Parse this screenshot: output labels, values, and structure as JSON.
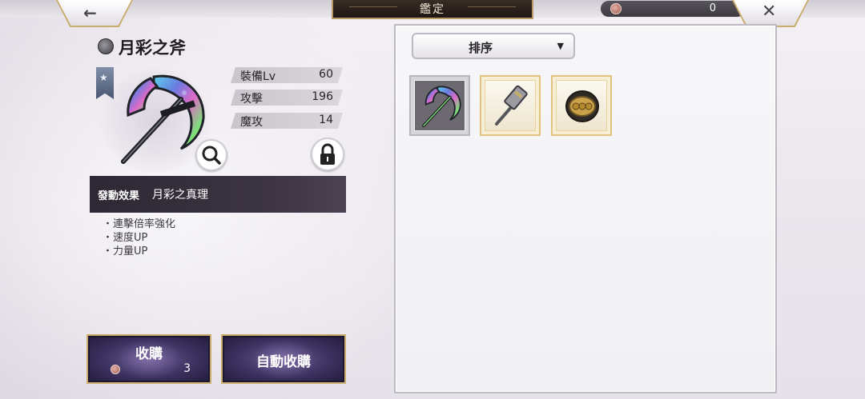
{
  "header": {
    "title": "鑑定",
    "back_icon": "←",
    "close_icon": "✕",
    "currency_amount": "0"
  },
  "item": {
    "name": "月彩之斧",
    "stats": [
      {
        "label": "裝備Lv",
        "value": "60"
      },
      {
        "label": "攻擊",
        "value": "196"
      },
      {
        "label": "魔攻",
        "value": "14"
      }
    ],
    "effect_heading": "發動效果",
    "effect_name": "月彩之真理",
    "effects": [
      "・連擊倍率強化",
      "・速度UP",
      "・力量UP"
    ]
  },
  "actions": {
    "buy_label": "收購",
    "buy_cost": "3",
    "auto_buy_label": "自動收購"
  },
  "inventory": {
    "sort_label": "排序",
    "items": [
      {
        "name": "moon-axe",
        "frame": "selected"
      },
      {
        "name": "hammer",
        "frame": "gold"
      },
      {
        "name": "ring-bracelet",
        "frame": "gold"
      }
    ]
  },
  "colors": {
    "accent_gold": "#c9ad6d",
    "button_purple": "#3c3160",
    "effect_bar": "#2e2834"
  }
}
